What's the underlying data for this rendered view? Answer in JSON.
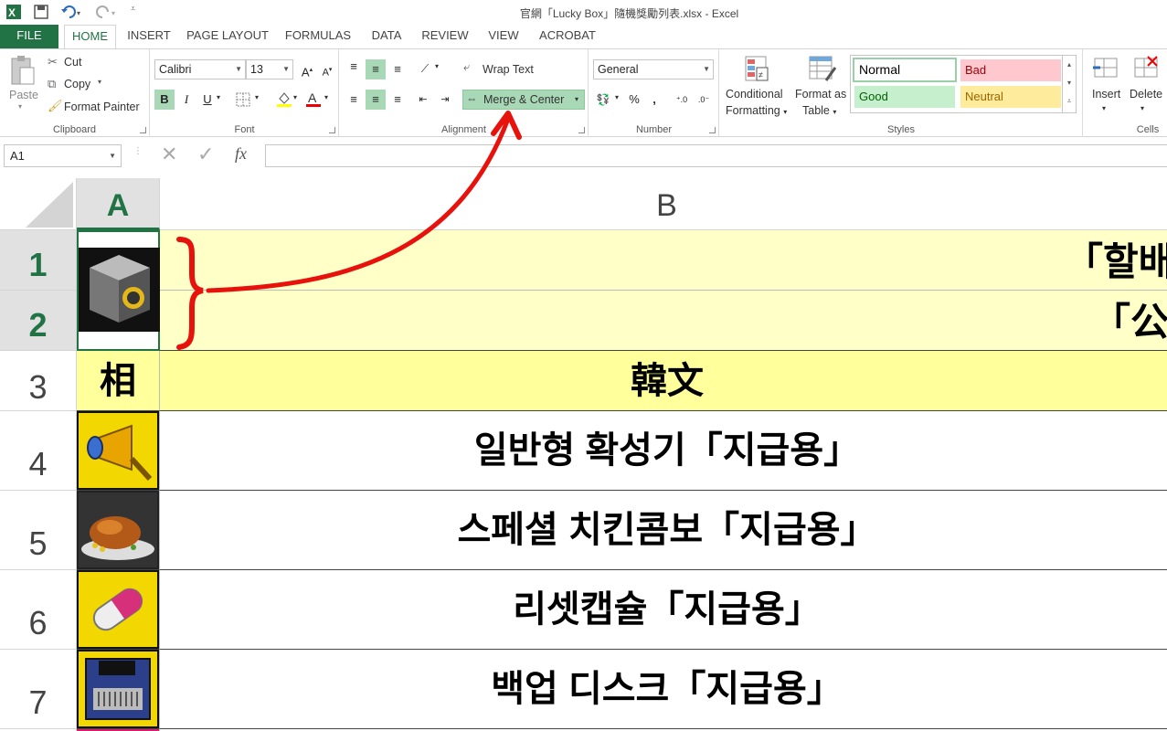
{
  "window": {
    "title": "官網「Lucky Box」隨機獎勵列表.xlsx - Excel"
  },
  "tabs": [
    "FILE",
    "HOME",
    "INSERT",
    "PAGE LAYOUT",
    "FORMULAS",
    "DATA",
    "REVIEW",
    "VIEW",
    "ACROBAT"
  ],
  "clipboard": {
    "paste": "Paste",
    "cut": "Cut",
    "copy": "Copy",
    "format_painter": "Format Painter",
    "label": "Clipboard"
  },
  "font": {
    "name": "Calibri",
    "size": "13",
    "label": "Font",
    "bold": "B",
    "italic": "I",
    "underline": "U"
  },
  "alignment": {
    "wrap_text": "Wrap Text",
    "merge_center": "Merge & Center",
    "label": "Alignment"
  },
  "number": {
    "format": "General",
    "label": "Number",
    "percent": "%",
    "comma": ","
  },
  "styles": {
    "cond_fmt_l1": "Conditional",
    "cond_fmt_l2": "Formatting",
    "fmt_table_l1": "Format as",
    "fmt_table_l2": "Table",
    "normal": "Normal",
    "bad": "Bad",
    "good": "Good",
    "neutral": "Neutral",
    "label": "Styles"
  },
  "cells_grp": {
    "insert": "Insert",
    "delete": "Delete",
    "label": "Cells"
  },
  "formula": {
    "namebox": "A1",
    "fx": "fx"
  },
  "columns": [
    "A",
    "B"
  ],
  "rows": [
    "1",
    "2",
    "3",
    "4",
    "5",
    "6",
    "7"
  ],
  "cells": {
    "r1": "「할배",
    "r2": "「公",
    "r3a": "相",
    "r3b": "韓文",
    "r4": "일반형 확성기「지급용」",
    "r5": "스페셜 치킨콤보「지급용」",
    "r6": "리셋캡슐「지급용」",
    "r7": "백업 디스크「지급용」"
  },
  "colors": {
    "accent": "#217346",
    "header_yellow": "#ffffc8",
    "row3_yellow": "#ffff9c",
    "arrow": "#e8120c"
  }
}
